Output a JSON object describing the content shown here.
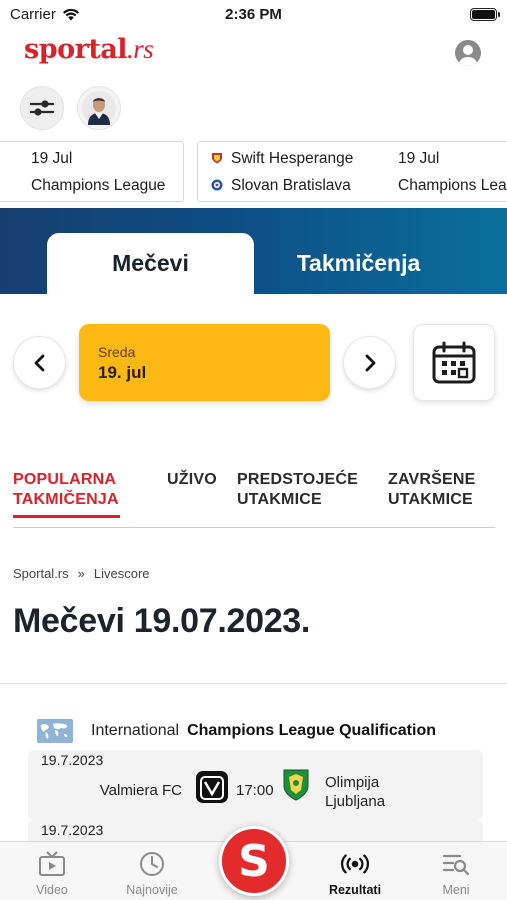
{
  "status_bar": {
    "carrier": "Carrier",
    "time": "2:36 PM"
  },
  "header": {
    "logo_main": "sportal",
    "logo_suffix": ".rs"
  },
  "ticker": [
    {
      "date": "19 Jul",
      "competition": "Champions League"
    },
    {
      "home": "Swift Hesperange",
      "away": "Slovan Bratislava",
      "date": "19 Jul",
      "competition": "Champions League"
    }
  ],
  "tabs": {
    "active": "Mečevi",
    "other": "Takmičenja"
  },
  "date_selector": {
    "day": "Sreda",
    "date": "19. jul"
  },
  "filter_tabs": [
    {
      "line1": "POPULARNA",
      "line2": "TAKMIČENJA",
      "active": true
    },
    {
      "line1": "UŽIVO",
      "line2": "",
      "active": false
    },
    {
      "line1": "PREDSTOJEĆE",
      "line2": "UTAKMICE",
      "active": false
    },
    {
      "line1": "ZAVRŠENE",
      "line2": "UTAKMICE",
      "active": false
    }
  ],
  "breadcrumb": {
    "home": "Sportal.rs",
    "separator": "»",
    "current": "Livescore"
  },
  "page_title": "Mečevi 19.07.2023.",
  "competition": {
    "country": "International",
    "name": "Champions League Qualification"
  },
  "matches": [
    {
      "date": "19.7.2023",
      "home": "Valmiera FC",
      "time": "17:00",
      "away_line1": "Olimpija",
      "away_line2": "Ljubljana"
    },
    {
      "date": "19.7.2023"
    }
  ],
  "bottom_nav": {
    "video": "Video",
    "najnovije": "Najnovije",
    "fab": "S",
    "rezultati": "Rezultati",
    "meni": "Meni"
  },
  "colors": {
    "brand_red": "#d8222c",
    "date_yellow": "#fdb813",
    "band_blue": "#0d4d84"
  }
}
